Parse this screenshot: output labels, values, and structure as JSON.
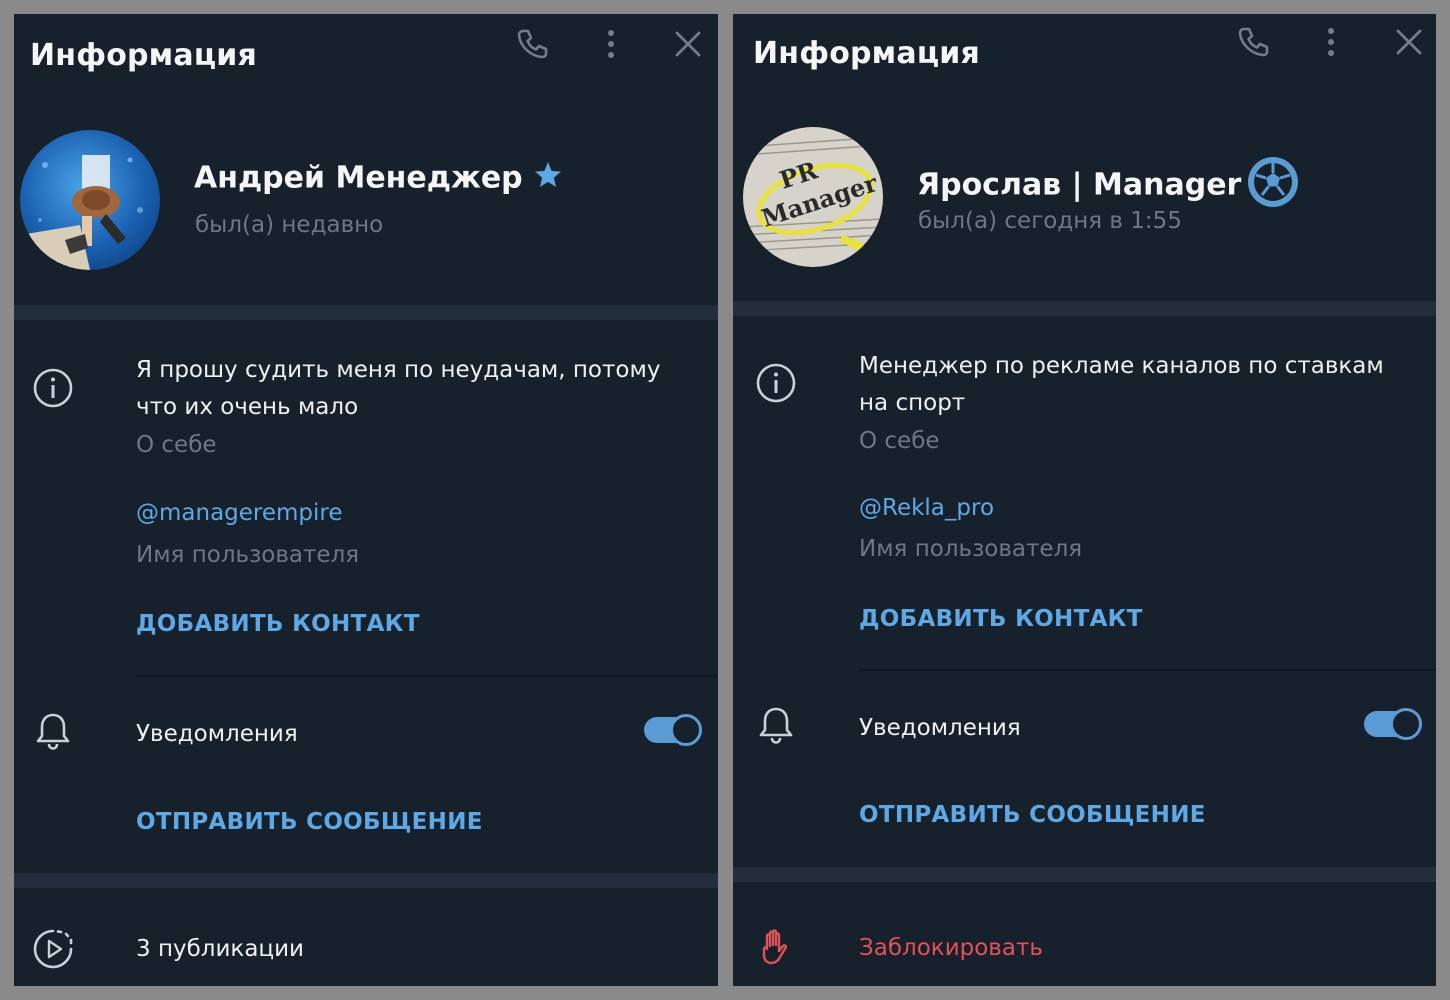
{
  "left_panel": {
    "title": "Информация",
    "name": "Андрей Менеджер",
    "name_badge": "star-icon",
    "status": "был(а) недавно",
    "bio": "Я прошу судить меня по неудачам, потому что их очень мало",
    "bio_label": "О себе",
    "username": "@managerempire",
    "username_label": "Имя пользователя",
    "add_contact": "ДОБАВИТЬ КОНТАКТ",
    "notifications_label": "Уведомления",
    "notifications_on": true,
    "send_message": "ОТПРАВИТЬ СООБЩЕНИЕ",
    "posts": "3 публикации"
  },
  "right_panel": {
    "title": "Информация",
    "name": "Ярослав | Manager",
    "name_badge": "soccer-ball-icon",
    "status": "был(а) сегодня в 1:55",
    "avatar_text": [
      "PR",
      "Manager"
    ],
    "bio": "Менеджер по рекламе каналов по ставкам на спорт",
    "bio_label": "О себе",
    "username": "@Rekla_pro",
    "username_label": "Имя пользователя",
    "add_contact": "ДОБАВИТЬ КОНТАКТ",
    "notifications_label": "Уведомления",
    "notifications_on": true,
    "send_message": "ОТПРАВИТЬ СООБЩЕНИЕ",
    "block": "Заблокировать"
  },
  "colors": {
    "panel_bg": "#17212b",
    "separator": "#232e3c",
    "accent": "#5fa8e6",
    "secondary_text": "#6d7883",
    "danger": "#e0515a"
  }
}
